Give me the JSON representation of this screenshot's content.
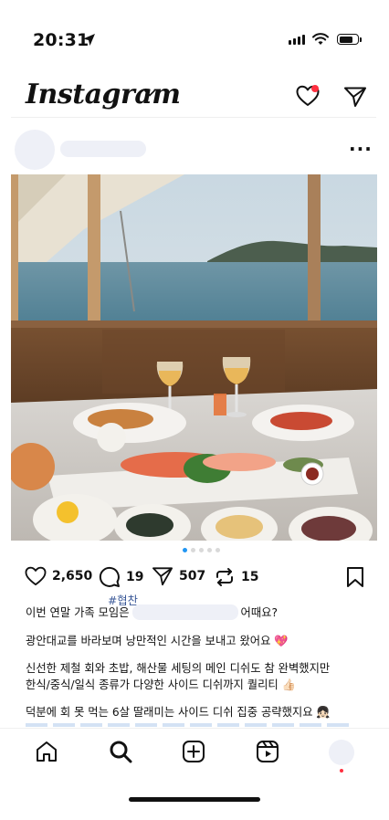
{
  "status_bar": {
    "time": "20:31"
  },
  "header": {
    "logo": "Instagram"
  },
  "post": {
    "dots": 5,
    "active_dot": 1,
    "likes": "2,650",
    "comments": "19",
    "shares": "507",
    "reposts": "15"
  },
  "caption": {
    "collab_tag": "#협찬",
    "line1_prefix": "이번 연말 가족 모임은",
    "line1_suffix": "어때요?",
    "line2": "광안대교를 바라보며 낭만적인 시간을 보내고 왔어요 💖",
    "line3": "신선한 제철 회와 초밥, 해산물 세팅의 메인 디쉬도 참 완벽했지만",
    "line4": "한식/중식/일식 종류가 다양한 사이드 디쉬까지 퀄리티 👍🏻",
    "line5": "덕분에 회 못 먹는 6살 딸래미는 사이드 디쉬 집중 공략했지요 👧🏻"
  },
  "colors": {
    "notification": "#ff3040",
    "active_dot": "#2196f3",
    "placeholder": "#eef0f7"
  }
}
